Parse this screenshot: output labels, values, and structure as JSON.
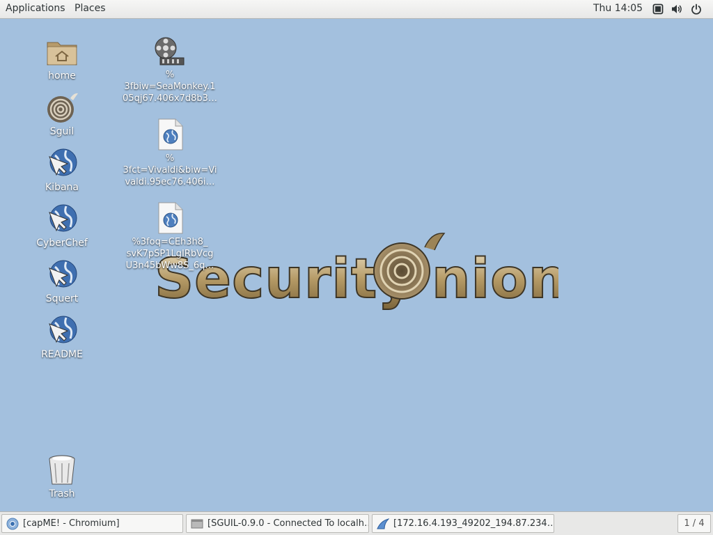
{
  "topbar": {
    "applications": "Applications",
    "places": "Places",
    "clock": "Thu 14:05",
    "tray_icons": [
      "screen-icon",
      "volume-icon",
      "power-icon"
    ]
  },
  "desktop": {
    "icons": [
      {
        "label": "home",
        "icon": "home-folder-icon"
      },
      {
        "label": "Sguil",
        "icon": "sguil-onion-icon"
      },
      {
        "label": "Kibana",
        "icon": "globe-link-icon"
      },
      {
        "label": "CyberChef",
        "icon": "globe-link-icon"
      },
      {
        "label": "Squert",
        "icon": "globe-link-icon"
      },
      {
        "label": "README",
        "icon": "globe-link-icon"
      },
      {
        "label": "Trash",
        "icon": "trash-icon"
      }
    ],
    "files": [
      {
        "line1": "%",
        "line2": "3fbiw=SeaMonkey.1",
        "line3": "05qj67.406x7d8b3…",
        "icon": "video-file-icon"
      },
      {
        "line1": "%",
        "line2": "3fct=Vivaldi&biw=Vi",
        "line3": "valdi.95ec76.406i…",
        "icon": "html-file-icon"
      },
      {
        "line1": "%3foq=CEh3h8_",
        "line2": "svK7pSP1LgIRbVcg",
        "line3": "U3n45bWw8S_6q…",
        "icon": "html-file-icon"
      }
    ],
    "wallpaper_text": "SecurityOnion"
  },
  "taskbar": {
    "tasks": [
      {
        "label": "[capME! - Chromium]",
        "icon": "chromium-icon"
      },
      {
        "label": "[SGUIL-0.9.0 - Connected To localh…",
        "icon": "window-icon"
      },
      {
        "label": "[172.16.4.193_49202_194.87.234…",
        "icon": "wireshark-icon"
      }
    ],
    "workspace": "1 / 4"
  }
}
